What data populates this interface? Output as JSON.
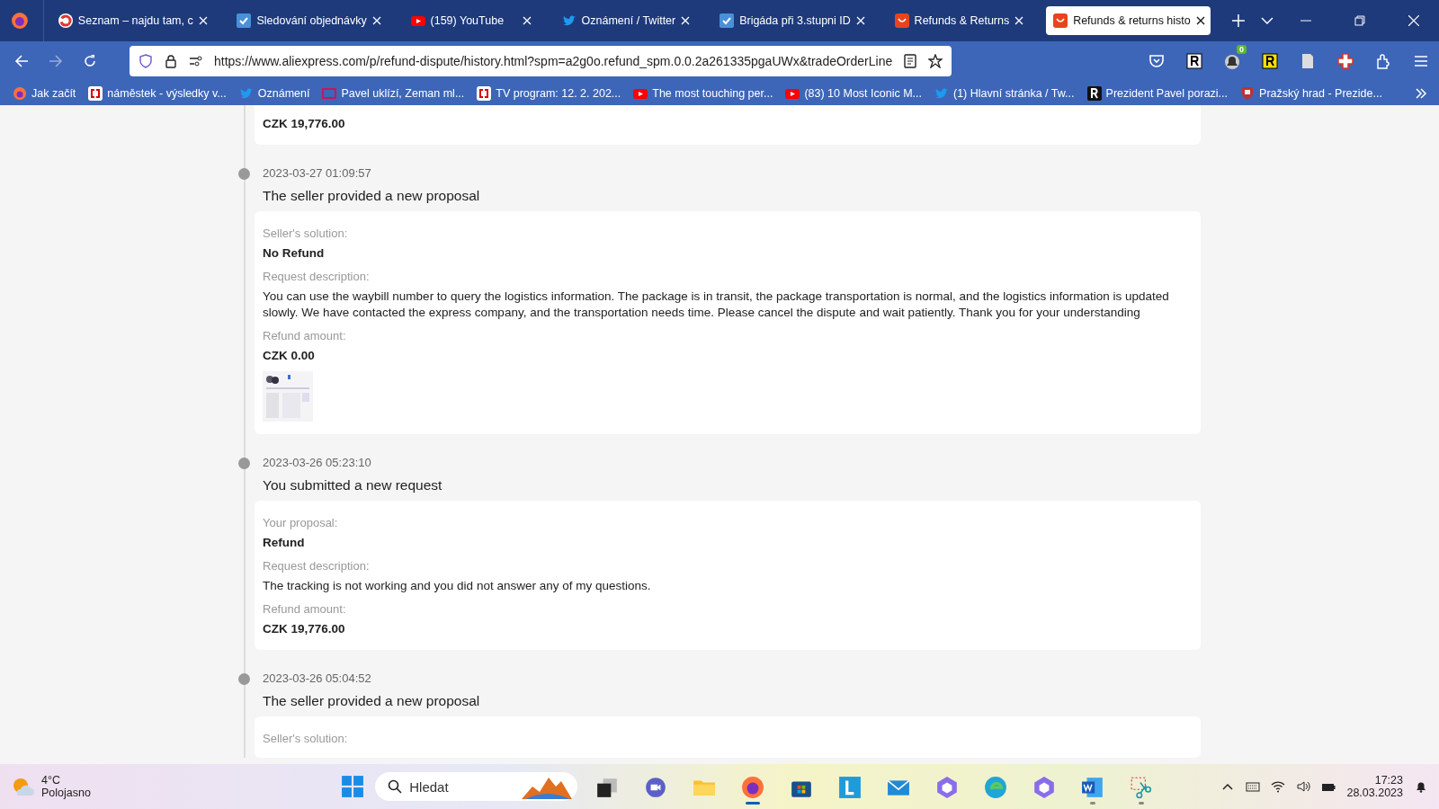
{
  "tabs": [
    {
      "label": "Seznam – najdu tam, c",
      "kind": "seznam",
      "selected": false
    },
    {
      "label": "Sledování objednávky",
      "kind": "check",
      "selected": false
    },
    {
      "label": "(159) YouTube",
      "kind": "youtube",
      "selected": false
    },
    {
      "label": "Oznámení / Twitter",
      "kind": "twitter",
      "selected": false
    },
    {
      "label": "Brigáda při 3.stupni ID",
      "kind": "check",
      "selected": false
    },
    {
      "label": "Refunds & Returns",
      "kind": "ali",
      "selected": false
    },
    {
      "label": "Refunds & returns histo",
      "kind": "ali",
      "selected": true
    }
  ],
  "address": {
    "url": "https://www.aliexpress.com/p/refund-dispute/history.html?spm=a2g0o.refund_spm.0.0.2a261335pgaUWx&tradeOrderLine"
  },
  "extensions": [
    {
      "kind": "pocket"
    },
    {
      "kind": "r-white"
    },
    {
      "kind": "badge",
      "badge": "0"
    },
    {
      "kind": "r-yellow"
    },
    {
      "kind": "page"
    },
    {
      "kind": "cross"
    },
    {
      "kind": "puzzle"
    }
  ],
  "bookmarks": [
    {
      "label": "Jak začít",
      "kind": "firefox"
    },
    {
      "label": "náměstek - výsledky v...",
      "kind": "ct"
    },
    {
      "label": "Oznámení",
      "kind": "twitter"
    },
    {
      "label": "Pavel uklízí, Zeman ml...",
      "kind": "frame"
    },
    {
      "label": "TV program: 12. 2. 202...",
      "kind": "ct"
    },
    {
      "label": "The most touching per...",
      "kind": "youtube"
    },
    {
      "label": "(83) 10 Most Iconic M...",
      "kind": "youtube"
    },
    {
      "label": "(1) Hlavní stránka / Tw...",
      "kind": "twitter"
    },
    {
      "label": "Prezident Pavel porazi...",
      "kind": "r"
    },
    {
      "label": "Pražský hrad - Prezide...",
      "kind": "crest"
    }
  ],
  "top_card": {
    "value": "CZK 19,776.00"
  },
  "events": [
    {
      "time": "2023-03-27 01:09:57",
      "title": "The seller provided a new proposal",
      "fields": [
        {
          "label": "Seller's solution:",
          "value": "No Refund",
          "kind": "bold"
        },
        {
          "label": "Request description:",
          "value": "You can use the waybill number to query the logistics information. The package is in transit, the package transportation is normal, and the logistics information is updated slowly. We have contacted the express company, and the transportation needs time. Please cancel the dispute and wait patiently. Thank you for your understanding",
          "kind": "plain"
        },
        {
          "label": "Refund amount:",
          "value": "CZK 0.00",
          "kind": "bold"
        }
      ]
    },
    {
      "time": "2023-03-26 05:23:10",
      "title": "You submitted a new request",
      "fields": [
        {
          "label": "Your proposal:",
          "value": "Refund",
          "kind": "bold"
        },
        {
          "label": "Request description:",
          "value": "The tracking is not working and you did not answer any of my questions.",
          "kind": "plain"
        },
        {
          "label": "Refund amount:",
          "value": "CZK 19,776.00",
          "kind": "bold"
        }
      ]
    },
    {
      "time": "2023-03-26 05:04:52",
      "title": "The seller provided a new proposal",
      "fields": [
        {
          "label": "Seller's solution:"
        }
      ]
    }
  ],
  "taskbar": {
    "weather": {
      "temp": "4°C",
      "condition": "Polojasno"
    },
    "search": {
      "placeholder": "Hledat"
    },
    "apps": [
      {
        "kind": "taskview",
        "running": false
      },
      {
        "kind": "teams",
        "running": false
      },
      {
        "kind": "folder",
        "running": false
      },
      {
        "kind": "firefox",
        "running": true
      },
      {
        "kind": "store",
        "running": false
      },
      {
        "kind": "l-app",
        "running": false
      },
      {
        "kind": "mail",
        "running": false
      },
      {
        "kind": "copilot",
        "running": false
      },
      {
        "kind": "edge",
        "running": false
      },
      {
        "kind": "copilot",
        "running": false
      },
      {
        "kind": "word",
        "running": true
      },
      {
        "kind": "snip",
        "running": true
      }
    ],
    "time": "17:23",
    "date": "28.03.2023"
  }
}
